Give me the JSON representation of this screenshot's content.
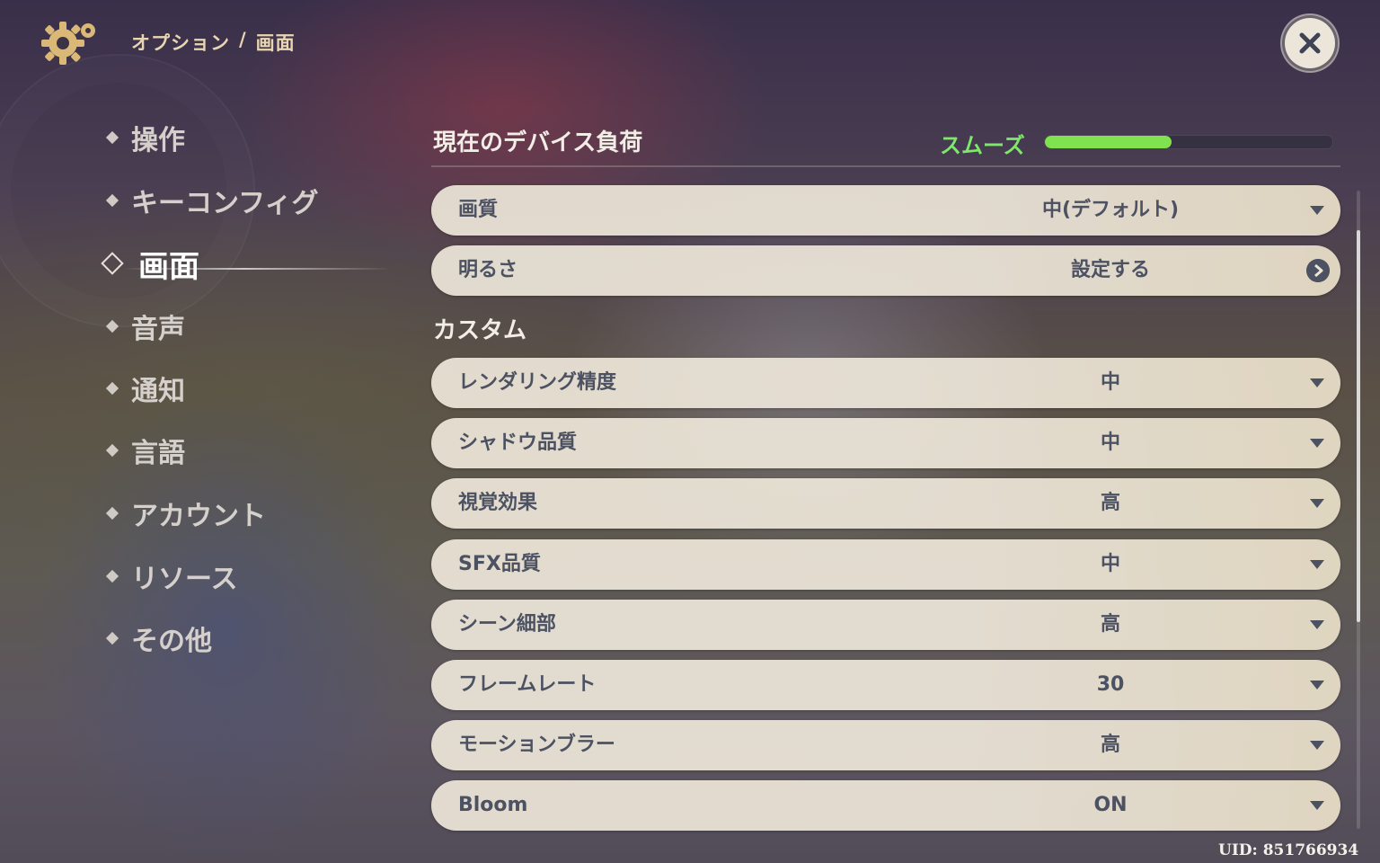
{
  "header": {
    "breadcrumb_section": "オプション",
    "breadcrumb_separator": "/",
    "breadcrumb_page": "画面",
    "settings_icon": "gear-icon",
    "close_icon": "close-icon"
  },
  "sidebar": {
    "items": [
      {
        "label": "操作",
        "active": false
      },
      {
        "label": "キーコンフィグ",
        "active": false
      },
      {
        "label": "画面",
        "active": true
      },
      {
        "label": "音声",
        "active": false
      },
      {
        "label": "通知",
        "active": false
      },
      {
        "label": "言語",
        "active": false
      },
      {
        "label": "アカウント",
        "active": false
      },
      {
        "label": "リソース",
        "active": false
      },
      {
        "label": "その他",
        "active": false
      }
    ]
  },
  "device_load": {
    "title": "現在のデバイス負荷",
    "status": "スムーズ",
    "level": 0.44,
    "status_color": "#7ee86a"
  },
  "general_settings": [
    {
      "label": "画質",
      "value": "中(デフォルト)",
      "control": "dropdown"
    },
    {
      "label": "明るさ",
      "value": "設定する",
      "control": "link"
    }
  ],
  "custom": {
    "title": "カスタム",
    "settings": [
      {
        "label": "レンダリング精度",
        "value": "中"
      },
      {
        "label": "シャドウ品質",
        "value": "中"
      },
      {
        "label": "視覚効果",
        "value": "高"
      },
      {
        "label": "SFX品質",
        "value": "中"
      },
      {
        "label": "シーン細部",
        "value": "高"
      },
      {
        "label": "フレームレート",
        "value": "30"
      },
      {
        "label": "モーションブラー",
        "value": "高"
      },
      {
        "label": "Bloom",
        "value": "ON"
      }
    ]
  },
  "footer": {
    "uid": "UID: 851766934"
  }
}
